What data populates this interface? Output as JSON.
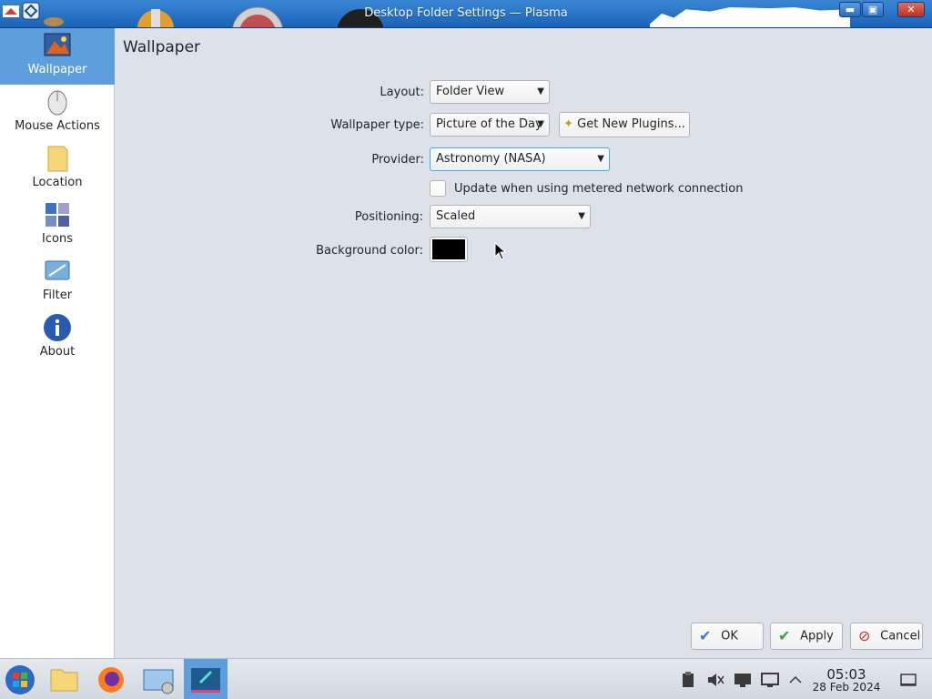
{
  "window": {
    "title": "Desktop Folder Settings — Plasma",
    "buttons": {
      "minimize": "▬",
      "maximize": "▣",
      "close": "✕"
    }
  },
  "sidebar": {
    "items": [
      {
        "label": "Wallpaper",
        "icon": "wallpaper-icon",
        "active": true
      },
      {
        "label": "Mouse Actions",
        "icon": "mouse-icon"
      },
      {
        "label": "Location",
        "icon": "folder-icon"
      },
      {
        "label": "Icons",
        "icon": "icons-icon"
      },
      {
        "label": "Filter",
        "icon": "filter-icon"
      },
      {
        "label": "About",
        "icon": "info-icon"
      }
    ]
  },
  "main": {
    "title": "Wallpaper",
    "layout": {
      "label": "Layout:",
      "value": "Folder View"
    },
    "wallpaper_type": {
      "label": "Wallpaper type:",
      "value": "Picture of the Day",
      "plugins_button": "Get New Plugins..."
    },
    "provider": {
      "label": "Provider:",
      "value": "Astronomy (NASA)"
    },
    "metered": {
      "label": "Update when using metered network connection",
      "checked": false
    },
    "positioning": {
      "label": "Positioning:",
      "value": "Scaled"
    },
    "background_color": {
      "label": "Background color:",
      "value": "#000000"
    }
  },
  "dialog_buttons": {
    "ok": "OK",
    "apply": "Apply",
    "cancel": "Cancel"
  },
  "taskbar": {
    "apps": [
      "start-menu-icon",
      "file-manager-icon",
      "firefox-icon",
      "system-settings-icon",
      "plasma-settings-icon"
    ],
    "tray": [
      "clipboard-icon",
      "volume-muted-icon",
      "display-icon",
      "network-icon",
      "expand-tray-icon"
    ],
    "clock": {
      "time": "05:03",
      "date": "28 Feb 2024"
    }
  },
  "colors": {
    "accent": "#5e9edc",
    "titlebar": "#2a6cc0",
    "background": "#dce1ea"
  }
}
